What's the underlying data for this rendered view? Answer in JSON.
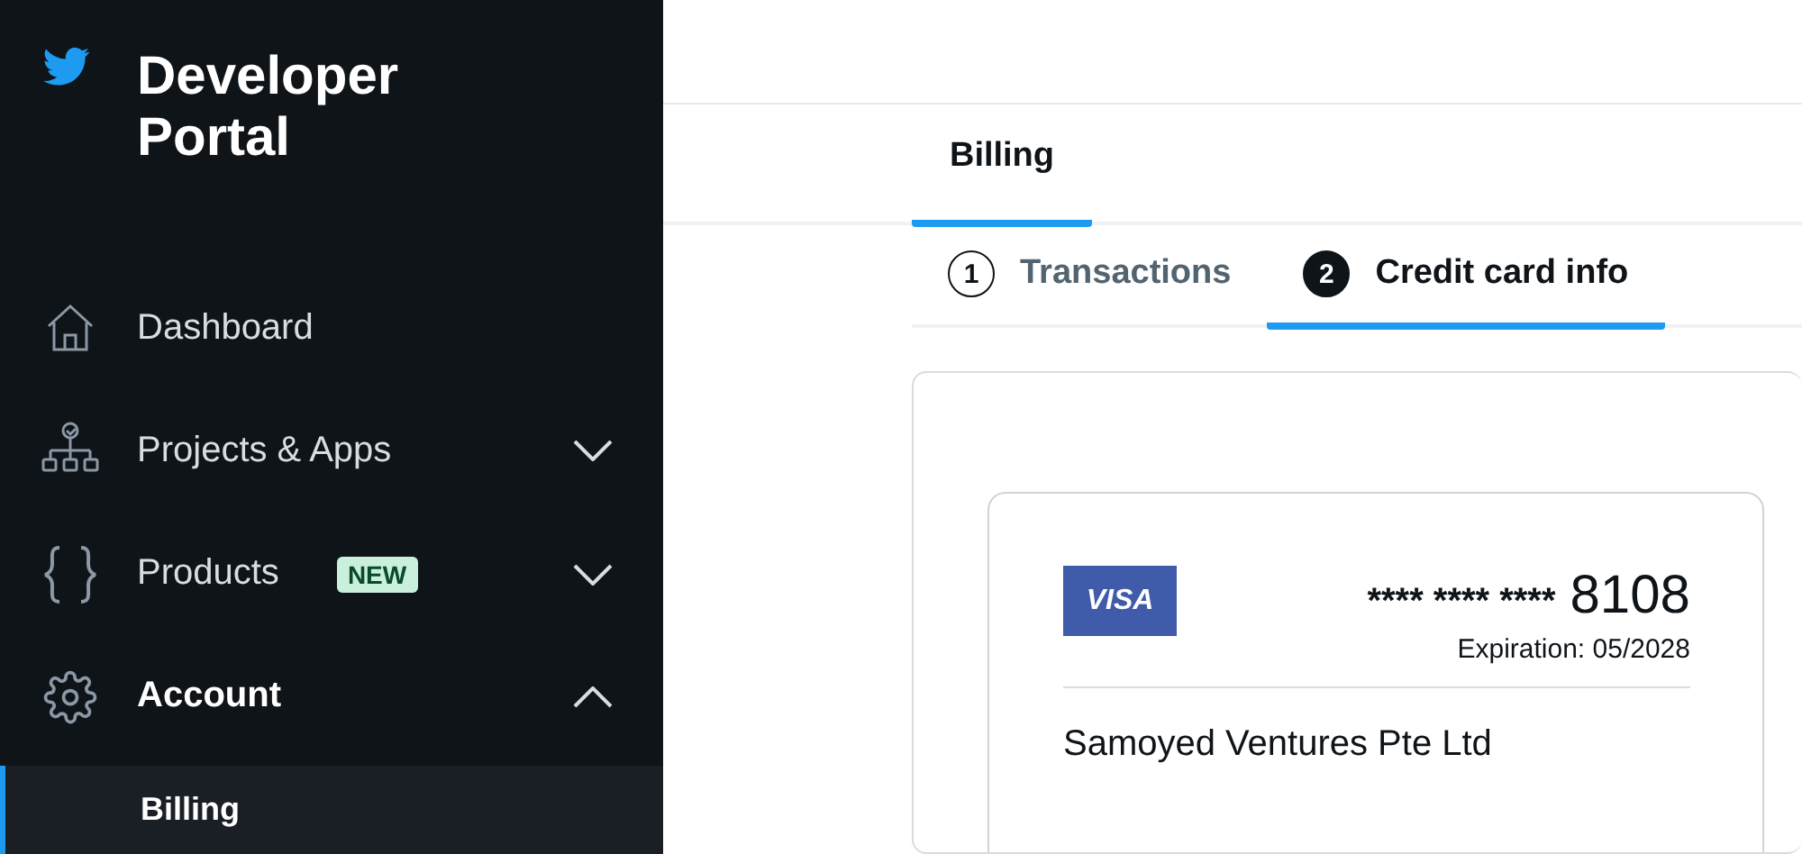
{
  "sidebar": {
    "title": "Developer Portal",
    "items": [
      {
        "label": "Dashboard",
        "selected": false
      },
      {
        "label": "Projects & Apps",
        "expanded": false,
        "selected": false
      },
      {
        "label": "Products",
        "badge": "NEW",
        "expanded": false,
        "selected": false
      },
      {
        "label": "Account",
        "expanded": true,
        "selected": true,
        "children": [
          {
            "label": "Billing",
            "selected": true
          }
        ]
      }
    ]
  },
  "tabs": [
    {
      "label": "Billing",
      "selected": true
    }
  ],
  "steps": [
    {
      "number": "1",
      "label": "Transactions",
      "selected": false
    },
    {
      "number": "2",
      "label": "Credit card info",
      "selected": true
    }
  ],
  "card": {
    "brand": "VISA",
    "number_mask": "**** **** ****",
    "last4": "8108",
    "expiration": "Expiration: 05/2028",
    "holder": "Samoyed Ventures Pte Ltd"
  }
}
